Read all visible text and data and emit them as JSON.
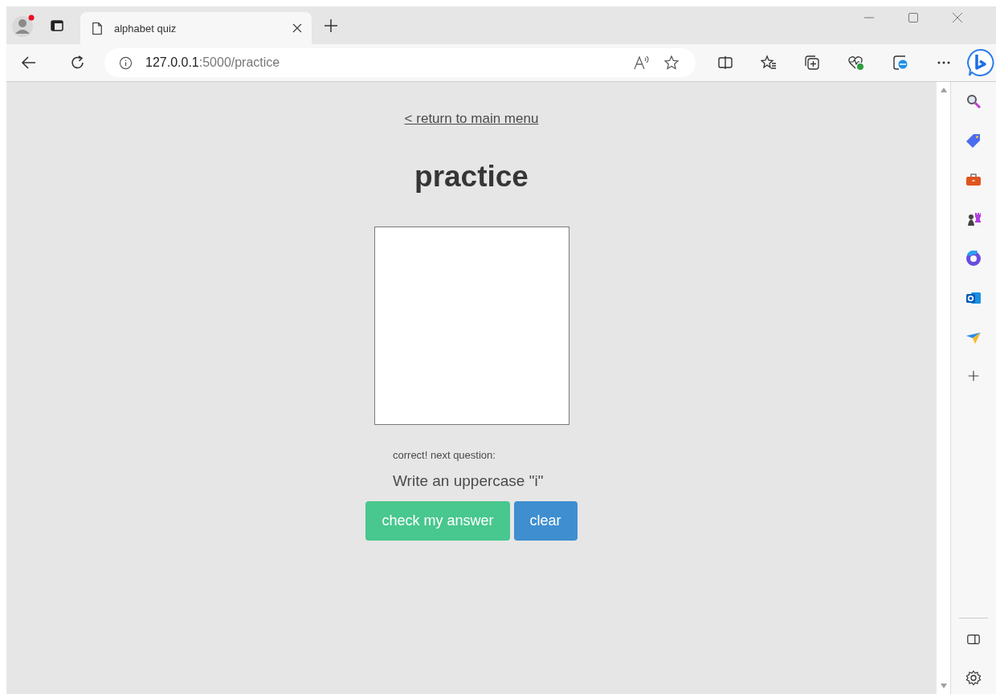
{
  "browser": {
    "tab": {
      "title": "alphabet quiz",
      "selected": true
    },
    "address": {
      "host": "127.0.0.1",
      "rest": ":5000/practice"
    }
  },
  "page": {
    "back_link": "< return to main menu",
    "heading": "practice",
    "feedback": "correct! next question:",
    "prompt": "Write an uppercase \"i\"",
    "buttons": [
      {
        "label": "check my answer",
        "kind": "primary"
      },
      {
        "label": "clear",
        "kind": "info"
      }
    ]
  }
}
